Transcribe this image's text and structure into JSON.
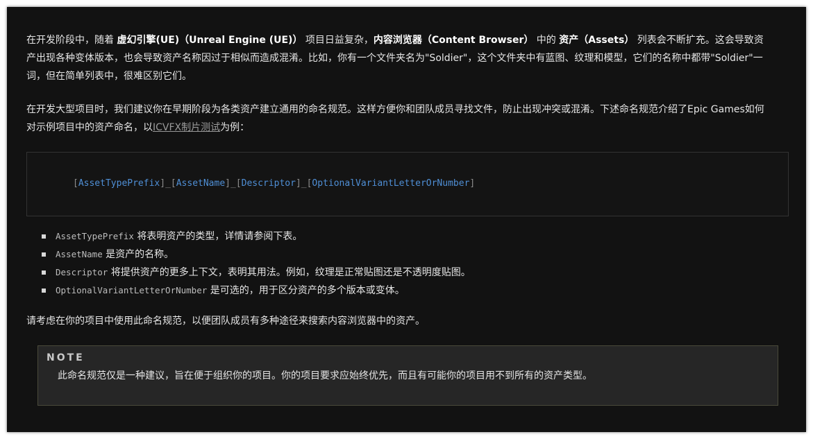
{
  "intro": {
    "t1": "在开发阶段中，随着 ",
    "b1": "虚幻引擎(UE)（Unreal Engine (UE)）",
    "t2": " 项目日益复杂，",
    "b2": "内容浏览器（Content Browser）",
    "t3": " 中的 ",
    "b3": "资产（Assets）",
    "t4": " 列表会不断扩充。这会导致资产出现各种变体版本，也会导致资产名称因过于相似而造成混淆。比如，你有一个文件夹名为\"Soldier\"，这个文件夹中有蓝图、纹理和模型，它们的名称中都带\"Soldier\"一词，但在简单列表中，很难区别它们。"
  },
  "recommend": {
    "text": "在开发大型项目时，我们建议你在早期阶段为各类资产建立通用的命名规范。这样方便你和团队成员寻找文件，防止出现冲突或混淆。下述命名规范介绍了Epic Games如何对示例项目中的资产命名，以",
    "link": "ICVFX制片测试",
    "suffix": "为例："
  },
  "code": {
    "tokens": [
      "AssetTypePrefix",
      "AssetName",
      "Descriptor",
      "OptionalVariantLetterOrNumber"
    ],
    "open": "[",
    "close": "]",
    "sep": "_"
  },
  "bullets": [
    {
      "code": "AssetTypePrefix",
      "text": " 将表明资产的类型，详情请参阅下表。"
    },
    {
      "code": "AssetName",
      "text": " 是资产的名称。"
    },
    {
      "code": "Descriptor",
      "text": " 将提供资产的更多上下文，表明其用法。例如，纹理是正常贴图还是不透明度贴图。"
    },
    {
      "code": "OptionalVariantLetterOrNumber",
      "text": " 是可选的，用于区分资产的多个版本或变体。"
    }
  ],
  "consider": "请考虑在你的项目中使用此命名规范，以便团队成员有多种途径来搜索内容浏览器中的资产。",
  "note": {
    "title": "NOTE",
    "body": "此命名规范仅是一种建议，旨在便于组织你的项目。你的项目要求应始终优先，而且有可能你的项目用不到所有的资产类型。"
  },
  "colors": {
    "background": "#121212",
    "token": "#4f8fd6",
    "link": "#9a9a9a",
    "note_bg": "#262626"
  }
}
